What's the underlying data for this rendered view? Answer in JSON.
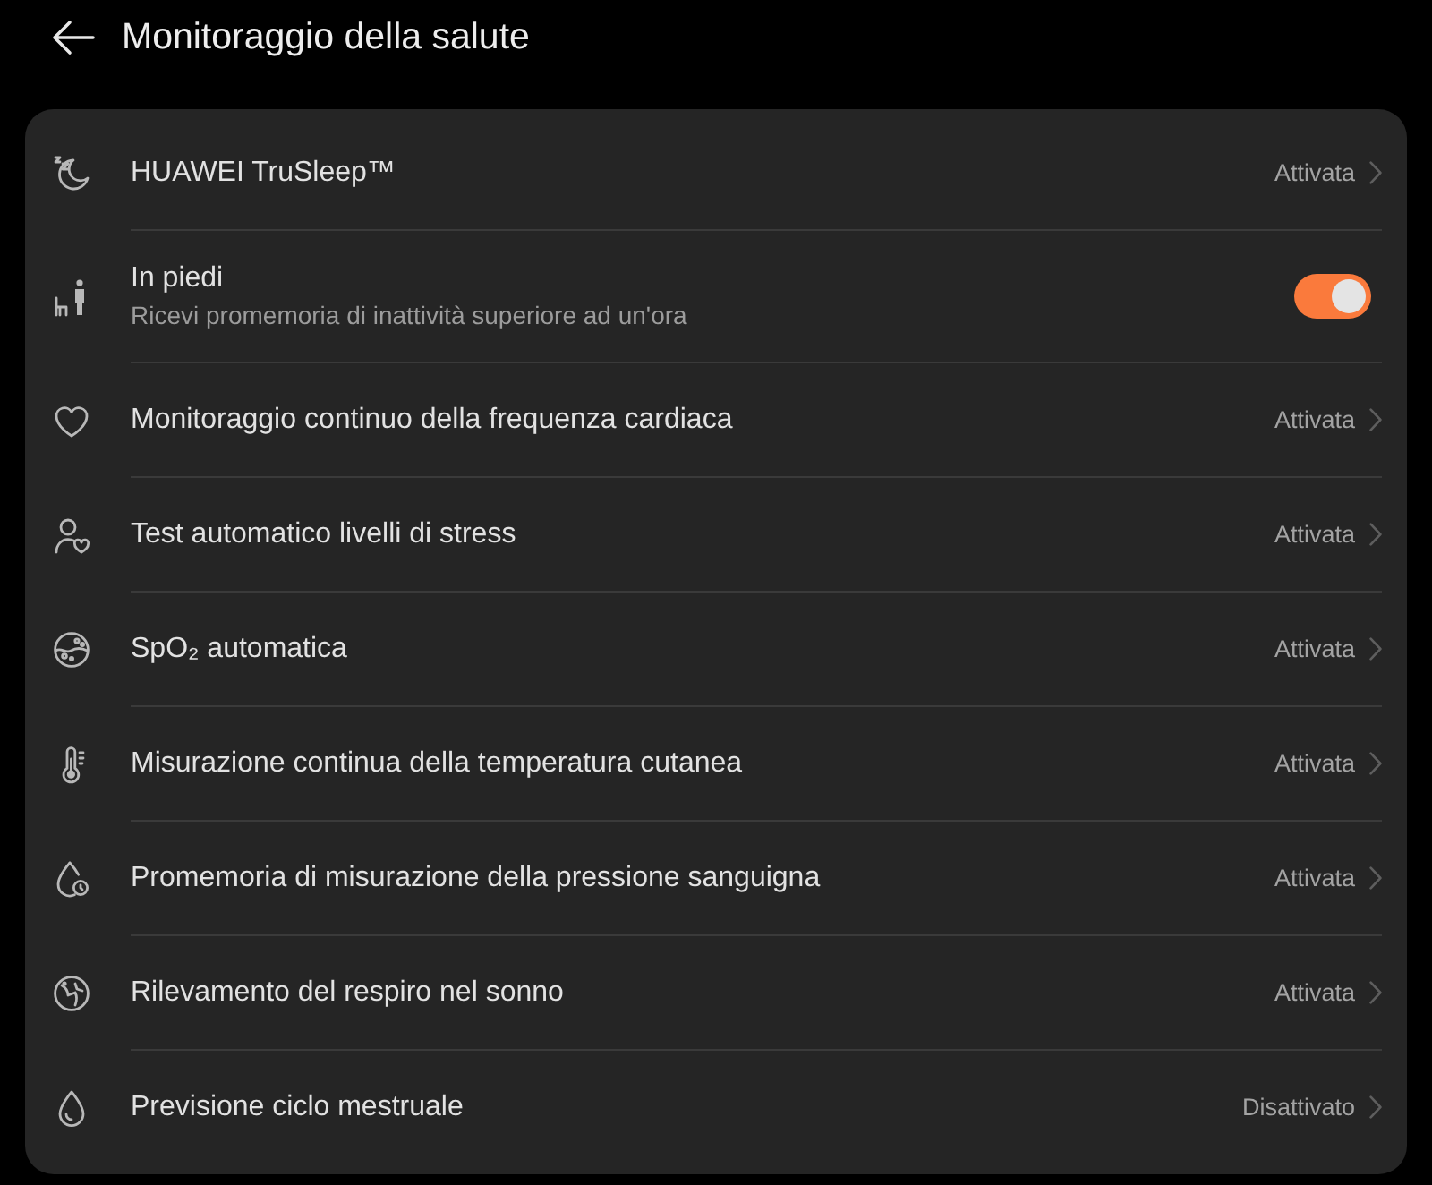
{
  "header": {
    "title": "Monitoraggio della salute"
  },
  "items": [
    {
      "kind": "link",
      "label": "HUAWEI TruSleep™",
      "value": "Attivata"
    },
    {
      "kind": "toggle",
      "label": "In piedi",
      "subtitle": "Ricevi promemoria di inattività superiore ad un'ora",
      "on": true
    },
    {
      "kind": "link",
      "label": "Monitoraggio continuo della frequenza cardiaca",
      "value": "Attivata"
    },
    {
      "kind": "link",
      "label": "Test automatico livelli di stress",
      "value": "Attivata"
    },
    {
      "kind": "link",
      "label": "SpO₂ automatica",
      "value": "Attivata"
    },
    {
      "kind": "link",
      "label": "Misurazione continua della temperatura cutanea",
      "value": "Attivata"
    },
    {
      "kind": "link",
      "label": "Promemoria di misurazione della pressione sanguigna",
      "value": "Attivata"
    },
    {
      "kind": "link",
      "label": "Rilevamento del respiro nel sonno",
      "value": "Attivata"
    },
    {
      "kind": "link",
      "label": "Previsione ciclo mestruale",
      "value": "Disattivato"
    }
  ]
}
